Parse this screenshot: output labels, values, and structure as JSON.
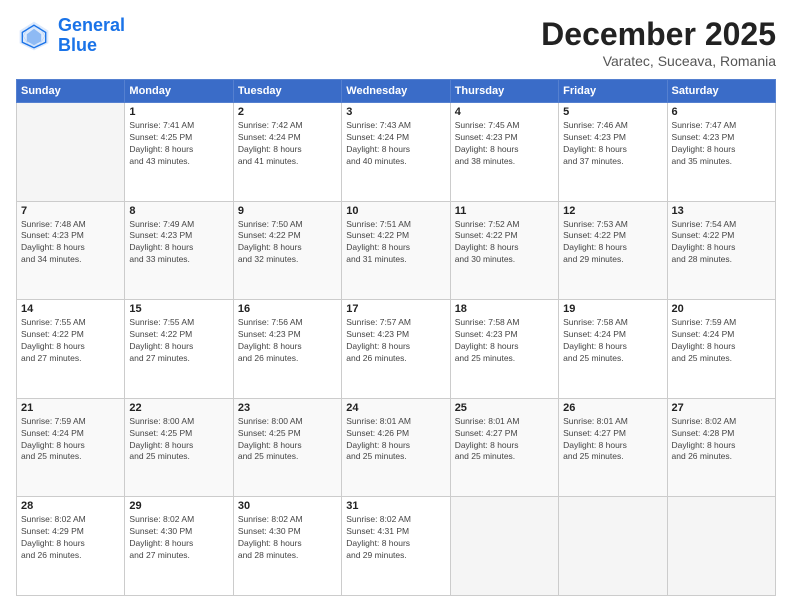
{
  "logo": {
    "line1": "General",
    "line2": "Blue"
  },
  "title": "December 2025",
  "location": "Varatec, Suceava, Romania",
  "days_of_week": [
    "Sunday",
    "Monday",
    "Tuesday",
    "Wednesday",
    "Thursday",
    "Friday",
    "Saturday"
  ],
  "weeks": [
    [
      {
        "day": "",
        "sunrise": "",
        "sunset": "",
        "daylight": "",
        "empty": true
      },
      {
        "day": "1",
        "sunrise": "Sunrise: 7:41 AM",
        "sunset": "Sunset: 4:25 PM",
        "daylight": "Daylight: 8 hours and 43 minutes."
      },
      {
        "day": "2",
        "sunrise": "Sunrise: 7:42 AM",
        "sunset": "Sunset: 4:24 PM",
        "daylight": "Daylight: 8 hours and 41 minutes."
      },
      {
        "day": "3",
        "sunrise": "Sunrise: 7:43 AM",
        "sunset": "Sunset: 4:24 PM",
        "daylight": "Daylight: 8 hours and 40 minutes."
      },
      {
        "day": "4",
        "sunrise": "Sunrise: 7:45 AM",
        "sunset": "Sunset: 4:23 PM",
        "daylight": "Daylight: 8 hours and 38 minutes."
      },
      {
        "day": "5",
        "sunrise": "Sunrise: 7:46 AM",
        "sunset": "Sunset: 4:23 PM",
        "daylight": "Daylight: 8 hours and 37 minutes."
      },
      {
        "day": "6",
        "sunrise": "Sunrise: 7:47 AM",
        "sunset": "Sunset: 4:23 PM",
        "daylight": "Daylight: 8 hours and 35 minutes."
      }
    ],
    [
      {
        "day": "7",
        "sunrise": "Sunrise: 7:48 AM",
        "sunset": "Sunset: 4:23 PM",
        "daylight": "Daylight: 8 hours and 34 minutes."
      },
      {
        "day": "8",
        "sunrise": "Sunrise: 7:49 AM",
        "sunset": "Sunset: 4:23 PM",
        "daylight": "Daylight: 8 hours and 33 minutes."
      },
      {
        "day": "9",
        "sunrise": "Sunrise: 7:50 AM",
        "sunset": "Sunset: 4:22 PM",
        "daylight": "Daylight: 8 hours and 32 minutes."
      },
      {
        "day": "10",
        "sunrise": "Sunrise: 7:51 AM",
        "sunset": "Sunset: 4:22 PM",
        "daylight": "Daylight: 8 hours and 31 minutes."
      },
      {
        "day": "11",
        "sunrise": "Sunrise: 7:52 AM",
        "sunset": "Sunset: 4:22 PM",
        "daylight": "Daylight: 8 hours and 30 minutes."
      },
      {
        "day": "12",
        "sunrise": "Sunrise: 7:53 AM",
        "sunset": "Sunset: 4:22 PM",
        "daylight": "Daylight: 8 hours and 29 minutes."
      },
      {
        "day": "13",
        "sunrise": "Sunrise: 7:54 AM",
        "sunset": "Sunset: 4:22 PM",
        "daylight": "Daylight: 8 hours and 28 minutes."
      }
    ],
    [
      {
        "day": "14",
        "sunrise": "Sunrise: 7:55 AM",
        "sunset": "Sunset: 4:22 PM",
        "daylight": "Daylight: 8 hours and 27 minutes."
      },
      {
        "day": "15",
        "sunrise": "Sunrise: 7:55 AM",
        "sunset": "Sunset: 4:22 PM",
        "daylight": "Daylight: 8 hours and 27 minutes."
      },
      {
        "day": "16",
        "sunrise": "Sunrise: 7:56 AM",
        "sunset": "Sunset: 4:23 PM",
        "daylight": "Daylight: 8 hours and 26 minutes."
      },
      {
        "day": "17",
        "sunrise": "Sunrise: 7:57 AM",
        "sunset": "Sunset: 4:23 PM",
        "daylight": "Daylight: 8 hours and 26 minutes."
      },
      {
        "day": "18",
        "sunrise": "Sunrise: 7:58 AM",
        "sunset": "Sunset: 4:23 PM",
        "daylight": "Daylight: 8 hours and 25 minutes."
      },
      {
        "day": "19",
        "sunrise": "Sunrise: 7:58 AM",
        "sunset": "Sunset: 4:24 PM",
        "daylight": "Daylight: 8 hours and 25 minutes."
      },
      {
        "day": "20",
        "sunrise": "Sunrise: 7:59 AM",
        "sunset": "Sunset: 4:24 PM",
        "daylight": "Daylight: 8 hours and 25 minutes."
      }
    ],
    [
      {
        "day": "21",
        "sunrise": "Sunrise: 7:59 AM",
        "sunset": "Sunset: 4:24 PM",
        "daylight": "Daylight: 8 hours and 25 minutes."
      },
      {
        "day": "22",
        "sunrise": "Sunrise: 8:00 AM",
        "sunset": "Sunset: 4:25 PM",
        "daylight": "Daylight: 8 hours and 25 minutes."
      },
      {
        "day": "23",
        "sunrise": "Sunrise: 8:00 AM",
        "sunset": "Sunset: 4:25 PM",
        "daylight": "Daylight: 8 hours and 25 minutes."
      },
      {
        "day": "24",
        "sunrise": "Sunrise: 8:01 AM",
        "sunset": "Sunset: 4:26 PM",
        "daylight": "Daylight: 8 hours and 25 minutes."
      },
      {
        "day": "25",
        "sunrise": "Sunrise: 8:01 AM",
        "sunset": "Sunset: 4:27 PM",
        "daylight": "Daylight: 8 hours and 25 minutes."
      },
      {
        "day": "26",
        "sunrise": "Sunrise: 8:01 AM",
        "sunset": "Sunset: 4:27 PM",
        "daylight": "Daylight: 8 hours and 25 minutes."
      },
      {
        "day": "27",
        "sunrise": "Sunrise: 8:02 AM",
        "sunset": "Sunset: 4:28 PM",
        "daylight": "Daylight: 8 hours and 26 minutes."
      }
    ],
    [
      {
        "day": "28",
        "sunrise": "Sunrise: 8:02 AM",
        "sunset": "Sunset: 4:29 PM",
        "daylight": "Daylight: 8 hours and 26 minutes."
      },
      {
        "day": "29",
        "sunrise": "Sunrise: 8:02 AM",
        "sunset": "Sunset: 4:30 PM",
        "daylight": "Daylight: 8 hours and 27 minutes."
      },
      {
        "day": "30",
        "sunrise": "Sunrise: 8:02 AM",
        "sunset": "Sunset: 4:30 PM",
        "daylight": "Daylight: 8 hours and 28 minutes."
      },
      {
        "day": "31",
        "sunrise": "Sunrise: 8:02 AM",
        "sunset": "Sunset: 4:31 PM",
        "daylight": "Daylight: 8 hours and 29 minutes."
      },
      {
        "day": "",
        "sunrise": "",
        "sunset": "",
        "daylight": "",
        "empty": true
      },
      {
        "day": "",
        "sunrise": "",
        "sunset": "",
        "daylight": "",
        "empty": true
      },
      {
        "day": "",
        "sunrise": "",
        "sunset": "",
        "daylight": "",
        "empty": true
      }
    ]
  ]
}
